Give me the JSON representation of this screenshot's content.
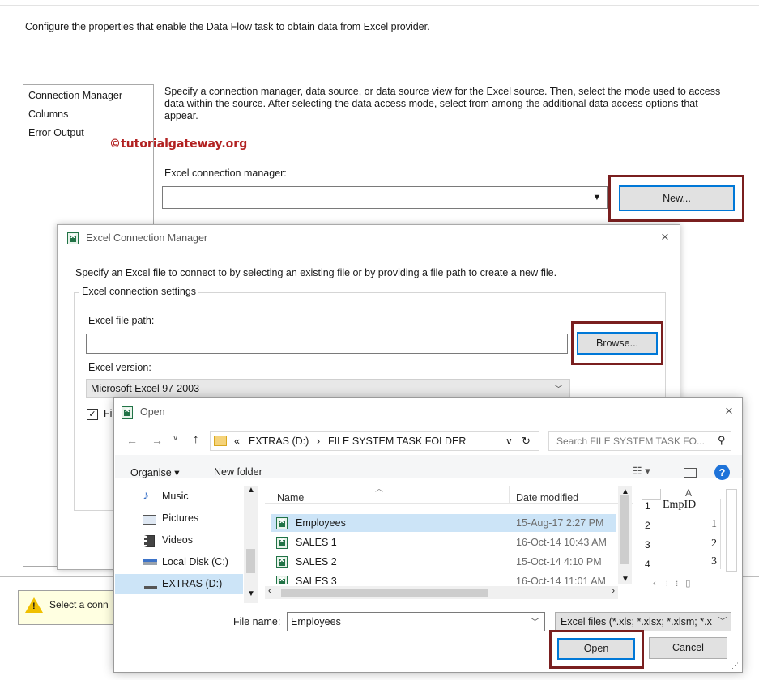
{
  "editor": {
    "description": "Configure the properties that enable the Data Flow task to obtain data from Excel provider.",
    "nav_items": [
      "Connection Manager",
      "Columns",
      "Error Output"
    ],
    "instructions": "Specify a connection manager, data source, or data source view for the Excel source. Then, select the mode used to access data within the source. After selecting the data access mode, select from among the additional data access options that appear.",
    "watermark": "©tutorialgateway.org",
    "excel_cm_label": "Excel connection manager:",
    "new_button": "New...",
    "warning_text": "Select a conn"
  },
  "ecm_dialog": {
    "title": "Excel Connection Manager",
    "instructions": "Specify an Excel file to connect to by selecting an existing file or by providing a file path to create a new file.",
    "group_label": "Excel connection settings",
    "file_path_label": "Excel file path:",
    "file_path_value": "",
    "browse_button": "Browse...",
    "version_label": "Excel version:",
    "version_value": "Microsoft Excel 97-2003",
    "checkbox_label": "Fi",
    "checkbox_checked": true
  },
  "open_dialog": {
    "title": "Open",
    "breadcrumb": [
      "«",
      "EXTRAS (D:)",
      "›",
      "FILE SYSTEM TASK FOLDER"
    ],
    "search_placeholder": "Search FILE SYSTEM TASK FO...",
    "organise_label": "Organise ▾",
    "new_folder_label": "New folder",
    "nav_items": [
      {
        "label": "Music",
        "icon": "music-icon"
      },
      {
        "label": "Pictures",
        "icon": "pictures-icon"
      },
      {
        "label": "Videos",
        "icon": "videos-icon"
      },
      {
        "label": "Local Disk (C:)",
        "icon": "drive-icon"
      },
      {
        "label": "EXTRAS (D:)",
        "icon": "drive-icon",
        "selected": true
      }
    ],
    "columns": {
      "name": "Name",
      "date": "Date modified"
    },
    "files": [
      {
        "name": "Employees",
        "date": "15-Aug-17 2:27 PM",
        "selected": true
      },
      {
        "name": "SALES 1",
        "date": "16-Oct-14 10:43 AM"
      },
      {
        "name": "SALES 2",
        "date": "15-Oct-14 4:10 PM"
      },
      {
        "name": "SALES 3",
        "date": "16-Oct-14 11:01 AM"
      }
    ],
    "preview": {
      "col_header": "A",
      "rows": [
        {
          "row": "1",
          "value": "EmpID"
        },
        {
          "row": "2",
          "value": "1"
        },
        {
          "row": "3",
          "value": "2"
        },
        {
          "row": "4",
          "value": "3"
        }
      ]
    },
    "file_name_label": "File name:",
    "file_name_value": "Employees",
    "filter_value": "Excel files (*.xls; *.xlsx; *.xlsm; *.x",
    "open_button": "Open",
    "cancel_button": "Cancel"
  },
  "colors": {
    "highlight": "#7a1f1f",
    "accent": "#0078d7",
    "watermark": "#b22222"
  }
}
